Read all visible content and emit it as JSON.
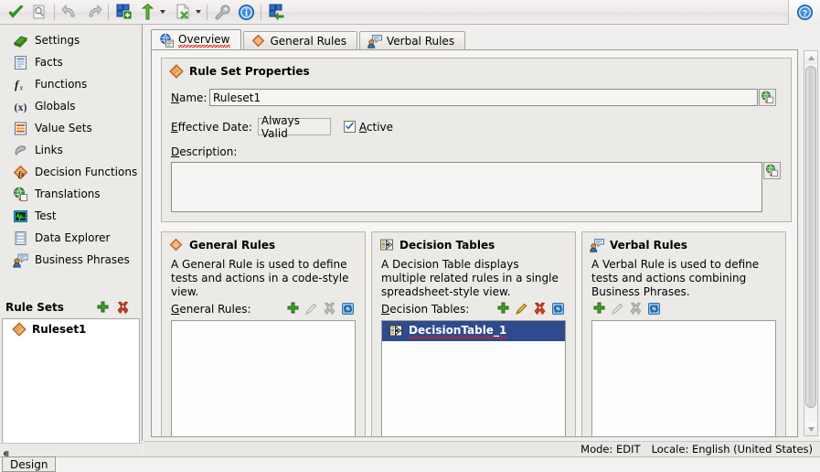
{
  "toolbar": {
    "buttons": [
      {
        "name": "validate-check-icon",
        "title": "Validate"
      },
      {
        "name": "search-document-icon",
        "title": "Find"
      },
      {
        "name": "undo-icon",
        "title": "Undo"
      },
      {
        "name": "redo-icon",
        "title": "Redo"
      },
      {
        "name": "add-ruleset-icon",
        "title": "Add Rule Set"
      },
      {
        "name": "promote-icon",
        "title": "Promote"
      },
      {
        "name": "remove-document-icon",
        "title": "Remove"
      },
      {
        "name": "wrench-icon",
        "title": "Tools"
      },
      {
        "name": "info-icon",
        "title": "Information"
      },
      {
        "name": "refresh-ruleset-icon",
        "title": "Refresh"
      }
    ],
    "help_label": "?"
  },
  "sidebar": {
    "items": [
      {
        "label": "Settings",
        "icon": "settings-book-icon"
      },
      {
        "label": "Facts",
        "icon": "facts-icon"
      },
      {
        "label": "Functions",
        "icon": "functions-fx-icon"
      },
      {
        "label": "Globals",
        "icon": "globals-x-icon"
      },
      {
        "label": "Value Sets",
        "icon": "value-sets-icon"
      },
      {
        "label": "Links",
        "icon": "links-icon"
      },
      {
        "label": "Decision Functions",
        "icon": "decision-functions-icon"
      },
      {
        "label": "Translations",
        "icon": "translations-icon"
      },
      {
        "label": "Test",
        "icon": "test-icon"
      },
      {
        "label": "Data Explorer",
        "icon": "data-explorer-icon"
      },
      {
        "label": "Business Phrases",
        "icon": "business-phrases-icon"
      }
    ],
    "rulesets": {
      "header": "Rule Sets",
      "add_icon": "add-icon",
      "delete_icon": "delete-icon",
      "items": [
        {
          "label": "Ruleset1",
          "icon": "ruleset-diamond-icon"
        }
      ]
    },
    "collapse_glyph": "∊"
  },
  "tabs": [
    {
      "label": "Overview",
      "icon": "overview-icon",
      "active": true,
      "spellerror": true
    },
    {
      "label": "General Rules",
      "icon": "general-rules-diamond-icon",
      "active": false,
      "spellerror": false
    },
    {
      "label": "Verbal Rules",
      "icon": "verbal-rules-icon",
      "active": false,
      "spellerror": false
    }
  ],
  "properties": {
    "title": "Rule Set Properties",
    "icon": "ruleset-diamond-icon",
    "name_label": "Name:",
    "name_value": "Ruleset1",
    "name_globe_icon": "translate-globe-icon",
    "effective_date_label": "Effective Date:",
    "effective_date_value": "Always Valid",
    "active_label": "Active",
    "active_checked": true,
    "description_label": "Description:",
    "description_value": "",
    "description_globe_icon": "translate-globe-icon"
  },
  "panels": [
    {
      "title": "General Rules",
      "icon": "general-rules-diamond-icon",
      "description": "A General Rule is used to define tests and actions in a code-style view.",
      "list_label": "General Rules:",
      "actions": [
        {
          "name": "add-icon",
          "enabled": true
        },
        {
          "name": "edit-pencil-icon",
          "enabled": false
        },
        {
          "name": "delete-icon",
          "enabled": false
        },
        {
          "name": "refresh-icon",
          "enabled": true
        }
      ],
      "items": []
    },
    {
      "title": "Decision Tables",
      "icon": "decision-table-icon",
      "description": "A Decision Table displays multiple related rules in a single spreadsheet-style view.",
      "list_label": "Decision Tables:",
      "actions": [
        {
          "name": "add-icon",
          "enabled": true
        },
        {
          "name": "edit-pencil-icon",
          "enabled": true
        },
        {
          "name": "delete-icon",
          "enabled": true
        },
        {
          "name": "refresh-icon",
          "enabled": true
        }
      ],
      "items": [
        {
          "label": "DecisionTable_1",
          "icon": "decision-table-icon",
          "selected": true,
          "spellerror": true
        }
      ]
    },
    {
      "title": "Verbal Rules",
      "icon": "verbal-rules-icon",
      "description": "A Verbal Rule is used to define tests and actions combining Business Phrases.",
      "list_label": "",
      "actions": [
        {
          "name": "add-icon",
          "enabled": true
        },
        {
          "name": "edit-pencil-icon",
          "enabled": false
        },
        {
          "name": "delete-icon",
          "enabled": false
        },
        {
          "name": "refresh-icon",
          "enabled": true
        }
      ],
      "items": []
    }
  ],
  "statusbar": {
    "mode": "Mode: EDIT",
    "locale": "Locale: English (United States)"
  },
  "bottom": {
    "design_tab": "Design"
  },
  "colors": {
    "selection_blue": "#2d4b8e",
    "accent_green": "#3a9c26",
    "accent_orange": "#d98736",
    "error_red": "#d40000"
  }
}
